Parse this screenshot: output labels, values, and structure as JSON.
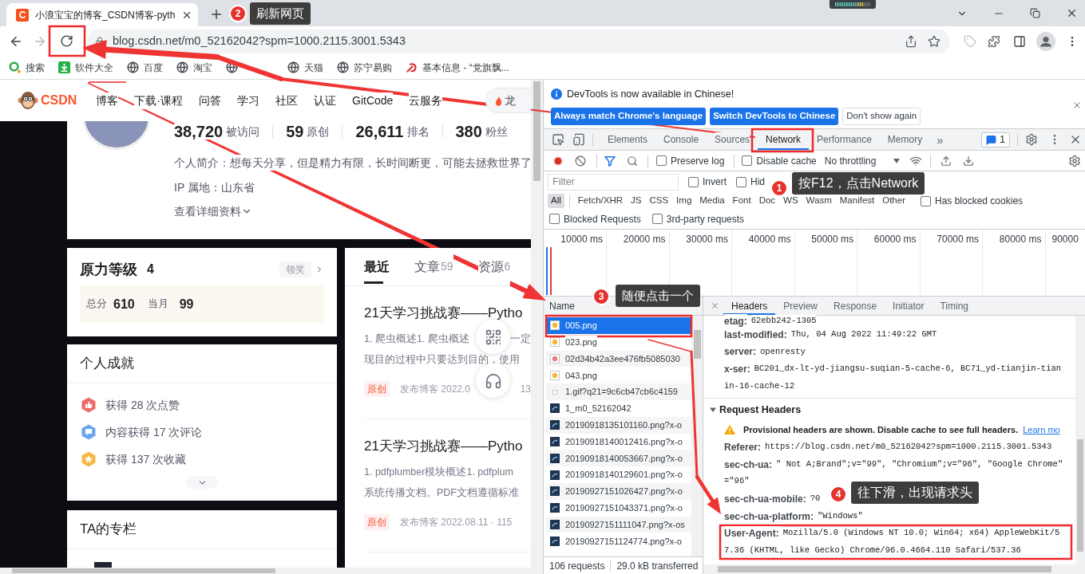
{
  "browser": {
    "tab": {
      "favicon": "C",
      "title": "小浪宝宝的博客_CSDN博客-pyth"
    },
    "url": "blog.csdn.net/m0_52162042?spm=1000.2115.3001.5343",
    "bookmarks": [
      {
        "kind": "search",
        "label": "搜索"
      },
      {
        "kind": "download",
        "label": "软件大全"
      },
      {
        "kind": "globe",
        "label": "百度"
      },
      {
        "kind": "globe",
        "label": "淘宝"
      },
      {
        "kind": "globe"
      },
      {
        "kind": "globe",
        "label": "天猫"
      },
      {
        "kind": "globe",
        "label": "苏宁易购"
      },
      {
        "kind": "emblem",
        "label": "基本信息 - “党旗飘..."
      }
    ]
  },
  "csdn": {
    "logo": "CSDN",
    "nav": [
      "博客",
      "下载·课程",
      "问答",
      "学习",
      "社区",
      "认证",
      "GitCode",
      "云服务"
    ],
    "search_hint": "龙",
    "stats": [
      {
        "value": "38,720",
        "label": "被访问"
      },
      {
        "value": "59",
        "label": "原创"
      },
      {
        "value": "26,611",
        "label": "排名"
      },
      {
        "value": "380",
        "label": "粉丝"
      }
    ],
    "bio": "个人简介：想每天分享，但是精力有限，长时间断更，可能去拯救世界了",
    "location": "IP 属地：山东省",
    "details_link": "查看详细资料",
    "level_card": {
      "title": "原力等级",
      "level": "4",
      "claim": "领奖",
      "total_label": "总分",
      "total": "610",
      "month_label": "当月",
      "month": "99"
    },
    "achievements": {
      "title": "个人成就",
      "items": [
        {
          "kind": "like",
          "text": "获得 28 次点赞"
        },
        {
          "kind": "comment",
          "text": "内容获得 17 次评论"
        },
        {
          "kind": "favorite",
          "text": "获得 137 次收藏"
        }
      ]
    },
    "columns_card": {
      "title": "TA的专栏"
    },
    "feed_tabs": [
      {
        "label": "最近",
        "selected": true
      },
      {
        "label": "文章",
        "count": "59",
        "selected": false
      },
      {
        "label": "资源",
        "count": "6",
        "selected": false
      }
    ],
    "articles": [
      {
        "title": "21天学习挑战赛——Pytho",
        "lines": [
          [
            "1. 爬虫概述1. 爬虫概述",
            "一定"
          ],
          [
            "现目的过程中只要达到目的，使用"
          ]
        ],
        "tag": "原创",
        "meta": [
          "发布博客 2022.0",
          "13"
        ]
      },
      {
        "title": "21天学习挑战赛——Pytho",
        "lines": [
          [
            "1. pdfplumber模块概述1. pdfplum"
          ],
          [
            "系统传播文档。PDF文档遵循标准"
          ]
        ],
        "tag": "原创",
        "meta": [
          "发布博客 2022.08.11 · 115"
        ]
      }
    ]
  },
  "devtools": {
    "infobar": {
      "message": "DevTools is now available in Chinese!",
      "buttons": [
        {
          "kind": "primary",
          "label": "Always match Chrome's language"
        },
        {
          "kind": "primary",
          "label": "Switch DevTools to Chinese"
        },
        {
          "kind": "secondary",
          "label": "Don't show again"
        }
      ]
    },
    "tabs": [
      {
        "label": "Elements",
        "selected": false
      },
      {
        "label": "Console",
        "selected": false
      },
      {
        "label": "Sources",
        "selected": false
      },
      {
        "label": "Network",
        "selected": true
      },
      {
        "label": "Performance",
        "selected": false
      },
      {
        "label": "Memory",
        "selected": false
      }
    ],
    "more_tabs": "»",
    "issues": "1",
    "toolbar": {
      "recording": true,
      "preserve_log": {
        "label": "Preserve log",
        "checked": false
      },
      "disable_cache": {
        "label": "Disable cache",
        "checked": false
      },
      "throttling": "No throttling"
    },
    "filter": {
      "placeholder": "Filter",
      "options": [
        {
          "label": "Invert",
          "checked": false
        },
        {
          "label": "Hid",
          "checked": false
        }
      ]
    },
    "types": [
      {
        "label": "All",
        "selected": true
      },
      {
        "label": "Fetch/XHR",
        "selected": false
      },
      {
        "label": "JS",
        "selected": false
      },
      {
        "label": "CSS",
        "selected": false
      },
      {
        "label": "Img",
        "selected": false
      },
      {
        "label": "Media",
        "selected": false
      },
      {
        "label": "Font",
        "selected": false
      },
      {
        "label": "Doc",
        "selected": false
      },
      {
        "label": "WS",
        "selected": false
      },
      {
        "label": "Wasm",
        "selected": false
      },
      {
        "label": "Manifest",
        "selected": false
      },
      {
        "label": "Other",
        "selected": false
      }
    ],
    "type_options": [
      {
        "label": "Has blocked cookies",
        "checked": false
      }
    ],
    "request_options": [
      {
        "label": "Blocked Requests",
        "checked": false
      },
      {
        "label": "3rd-party requests",
        "checked": false
      }
    ],
    "timeline_ticks": [
      "10000 ms",
      "20000 ms",
      "30000 ms",
      "40000 ms",
      "50000 ms",
      "60000 ms",
      "70000 ms",
      "80000 ms",
      "90000"
    ],
    "name_header": "Name",
    "requests": [
      {
        "name": "005.png",
        "kind": "sticker",
        "selected": true
      },
      {
        "name": "023.png",
        "kind": "sticker",
        "selected": false
      },
      {
        "name": "02d34b42a3ee476fb5085030",
        "kind": "seal",
        "selected": false
      },
      {
        "name": "043.png",
        "kind": "sticker",
        "selected": false
      },
      {
        "name": "1.gif?q21=9c6cb47cb6c4159",
        "kind": "pixel",
        "selected": false
      },
      {
        "name": "1_m0_52162042",
        "kind": "photo",
        "selected": false
      },
      {
        "name": "20190918135101160.png?x-o",
        "kind": "photo",
        "selected": false
      },
      {
        "name": "20190918140012416.png?x-o",
        "kind": "photo",
        "selected": false
      },
      {
        "name": "20190918140053667.png?x-o",
        "kind": "photo",
        "selected": false
      },
      {
        "name": "20190918140129601.png?x-o",
        "kind": "photo",
        "selected": false
      },
      {
        "name": "20190927151026427.png?x-o",
        "kind": "photo",
        "selected": false
      },
      {
        "name": "20190927151043371.png?x-o",
        "kind": "photo",
        "selected": false
      },
      {
        "name": "20190927151111047.png?x-os",
        "kind": "photo",
        "selected": false
      },
      {
        "name": "20190927151124774.png?x-o",
        "kind": "photo",
        "selected": false
      }
    ],
    "status": [
      "106 requests",
      "29.0 kB transferred"
    ],
    "detail_tabs": [
      {
        "label": "Headers",
        "selected": true
      },
      {
        "label": "Preview",
        "selected": false
      },
      {
        "label": "Response",
        "selected": false
      },
      {
        "label": "Initiator",
        "selected": false
      },
      {
        "label": "Timing",
        "selected": false
      }
    ],
    "response_headers": [
      {
        "key": "etag:",
        "lines": [
          "62ebb242-1305"
        ]
      },
      {
        "key": "last-modified:",
        "lines": [
          "Thu, 04 Aug 2022 11:49:22 GMT"
        ]
      },
      {
        "key": "server:",
        "lines": [
          "openresty"
        ]
      },
      {
        "key": "x-ser:",
        "lines": [
          "BC201_dx-lt-yd-jiangsu-suqian-5-cache-6, BC71_yd-tianjin-tian",
          "in-16-cache-12"
        ]
      }
    ],
    "request_section": {
      "title": "Request Headers",
      "expanded": true,
      "warning": "Provisional headers are shown. Disable cache to see full headers.",
      "link": "Learn mo",
      "headers": [
        {
          "key": "Referer:",
          "lines": [
            "https://blog.csdn.net/m0_52162042?spm=1000.2115.3001.5343"
          ]
        },
        {
          "key": "sec-ch-ua:",
          "lines": [
            "\" Not A;Brand\";v=\"99\", \"Chromium\";v=\"96\", \"Google Chrome\"",
            "=\"96\""
          ]
        },
        {
          "key": "sec-ch-ua-mobile:",
          "lines": [
            "?0"
          ]
        },
        {
          "key": "sec-ch-ua-platform:",
          "lines": [
            "\"Windows\""
          ]
        },
        {
          "key": "User-Agent:",
          "lines": [
            "Mozilla/5.0 (Windows NT 10.0; Win64; x64) AppleWebKit/5",
            "7.36 (KHTML, like Gecko) Chrome/96.0.4664.110 Safari/537.36"
          ]
        }
      ]
    }
  },
  "annotations": [
    {
      "number": "1",
      "text": "按F12，点击Network"
    },
    {
      "number": "2",
      "text": "刷新网页"
    },
    {
      "number": "3",
      "text": "随便点击一个"
    },
    {
      "number": "4",
      "text": "往下滑，出现请求头"
    }
  ]
}
